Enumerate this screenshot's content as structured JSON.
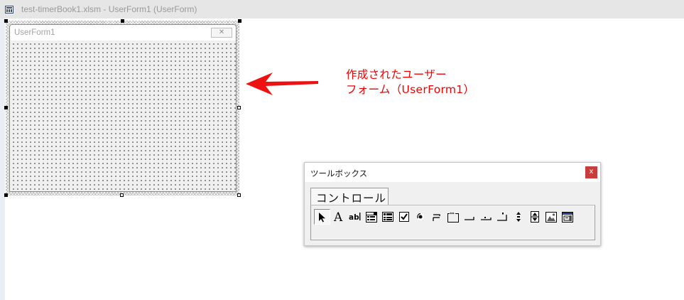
{
  "window": {
    "title": "test-timerBook1.xlsm - UserForm1 (UserForm)"
  },
  "userform": {
    "caption": "UserForm1",
    "close_glyph": "✕"
  },
  "annotation": {
    "line1": "作成されたユーザー",
    "line2": "フォーム（UserForm1）",
    "color": "#ee0000"
  },
  "toolbox": {
    "title": "ツールボックス",
    "close_glyph": "x",
    "tab_label": "コントロール",
    "tools": [
      {
        "name": "select-objects-icon"
      },
      {
        "name": "label-icon"
      },
      {
        "name": "textbox-icon"
      },
      {
        "name": "combobox-icon"
      },
      {
        "name": "listbox-icon"
      },
      {
        "name": "checkbox-icon"
      },
      {
        "name": "optionbutton-icon"
      },
      {
        "name": "togglebutton-icon"
      },
      {
        "name": "frame-icon"
      },
      {
        "name": "commandbutton-icon"
      },
      {
        "name": "tabstrip-icon"
      },
      {
        "name": "multipage-icon"
      },
      {
        "name": "scrollbar-icon"
      },
      {
        "name": "spinbutton-icon"
      },
      {
        "name": "image-icon"
      },
      {
        "name": "refedit-icon"
      }
    ]
  }
}
